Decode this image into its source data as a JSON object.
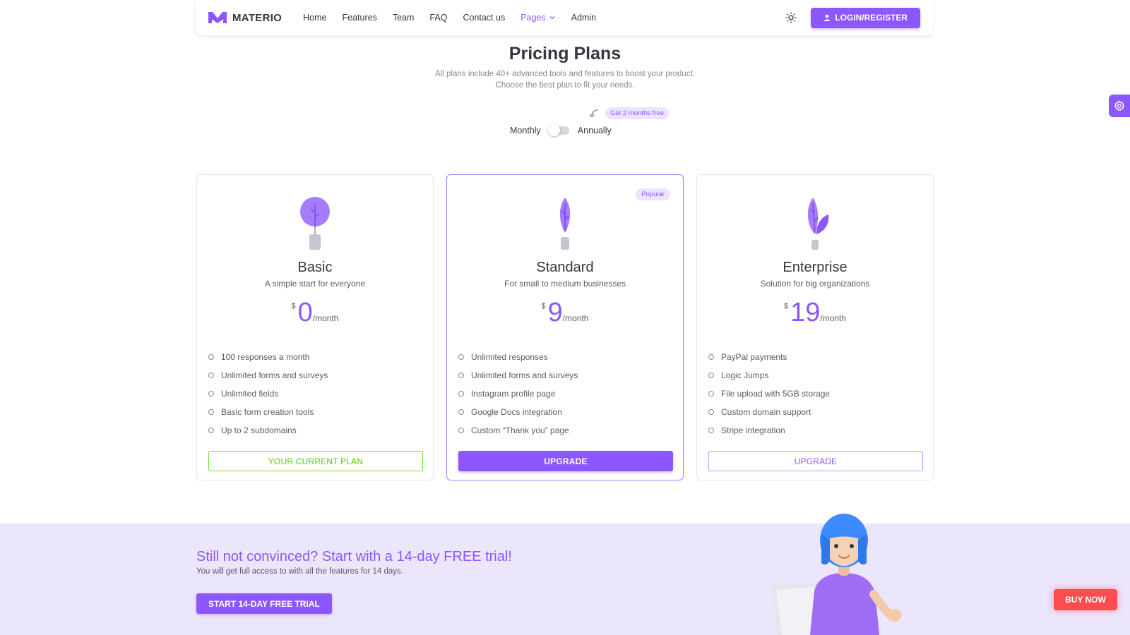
{
  "navbar": {
    "brand": "MATERIO",
    "links": [
      {
        "label": "Home"
      },
      {
        "label": "Features"
      },
      {
        "label": "Team"
      },
      {
        "label": "FAQ"
      },
      {
        "label": "Contact us"
      },
      {
        "label": "Pages",
        "active": true
      },
      {
        "label": "Admin"
      }
    ],
    "login_label": "LOGIN/REGISTER",
    "accent_color": "#8c57ff"
  },
  "header": {
    "title": "Pricing Plans",
    "subtitle_line1": "All plans include 40+ advanced tools and features to boost your product.",
    "subtitle_line2": "Choose the best plan to fit your needs.",
    "promo_badge": "Get 2 months free",
    "toggle_left": "Monthly",
    "toggle_right": "Annually",
    "toggle_state": "monthly"
  },
  "plans": [
    {
      "name": "Basic",
      "description": "A simple start for everyone",
      "currency": "$",
      "price": "0",
      "period": "/month",
      "features": [
        "100 responses a month",
        "Unlimited forms and surveys",
        "Unlimited fields",
        "Basic form creation tools",
        "Up to 2 subdomains"
      ],
      "button_label": "YOUR CURRENT PLAN",
      "illustration": "round-tree-pot"
    },
    {
      "name": "Standard",
      "description": "For small to medium businesses",
      "currency": "$",
      "price": "9",
      "period": "/month",
      "badge": "Popular",
      "features": [
        "Unlimited responses",
        "Unlimited forms and surveys",
        "Instagram profile page",
        "Google Docs integration",
        "Custom “Thank you” page"
      ],
      "button_label": "UPGRADE",
      "illustration": "tall-plant-pot"
    },
    {
      "name": "Enterprise",
      "description": "Solution for big organizations",
      "currency": "$",
      "price": "19",
      "period": "/month",
      "features": [
        "PayPal payments",
        "Logic Jumps",
        "File upload with 5GB storage",
        "Custom domain support",
        "Stripe integration"
      ],
      "button_label": "UPGRADE",
      "illustration": "leaf-plant-pot"
    }
  ],
  "trial": {
    "title": "Still not convinced? Start with a 14-day FREE trial!",
    "subtitle": "You will get full access to with all the features for 14 days.",
    "button_label": "START 14-DAY FREE TRIAL",
    "background_color": "#ece6fc"
  },
  "floating": {
    "settings_icon": "gear-icon",
    "buy_now_label": "BUY NOW",
    "buy_now_color": "#ff4c51"
  }
}
